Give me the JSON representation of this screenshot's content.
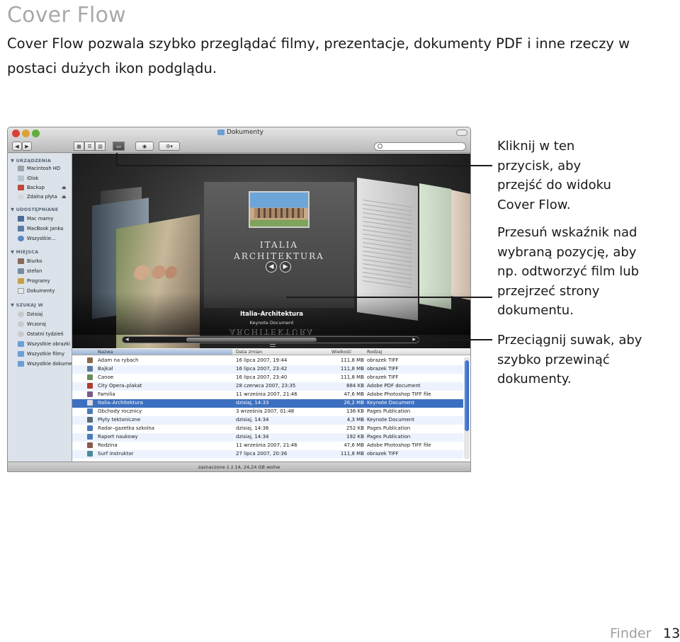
{
  "page": {
    "title": "Cover Flow",
    "intro": "Cover Flow pozwala szybko przeglądać filmy, prezentacje, dokumenty PDF i inne rzeczy w postaci dużych ikon podglądu.",
    "footer_section": "Finder",
    "page_number": "13"
  },
  "window": {
    "title": "Dokumenty",
    "search_placeholder": "",
    "status": "zaznaczone 1 z 14, 24,24 GB wolne"
  },
  "sidebar": {
    "sections": [
      {
        "header": "URZĄDZENIA",
        "items": [
          "Macintosh HD",
          "iDisk",
          "Backup",
          "Zdalna płyta"
        ]
      },
      {
        "header": "UDOSTĘPNIANE",
        "items": [
          "Mac mamy",
          "MacBook Janka",
          "Wszystkie..."
        ]
      },
      {
        "header": "MIEJSCA",
        "items": [
          "Biurko",
          "stefan",
          "Programy",
          "Dokumenty"
        ]
      },
      {
        "header": "SZUKAJ W",
        "items": [
          "Dzisiaj",
          "Wczoraj",
          "Ostatni tydzień",
          "Wszystkie obrazki",
          "Wszystkie filmy",
          "Wszystkie dokumenty"
        ]
      }
    ]
  },
  "coverflow": {
    "card_title_line1": "ITALIA",
    "card_title_line2": "ARCHITEKTURA",
    "caption_name": "Italia–Architektura",
    "caption_kind": "Keynote Document",
    "reflection_text": "ARCHITEKTURA"
  },
  "filelist": {
    "columns": [
      "Nazwa",
      "Data zmian",
      "Wielkość",
      "Rodzaj"
    ],
    "rows": [
      {
        "name": "Adam na rybach",
        "date": "16 lipca 2007, 19:44",
        "size": "111,8 MB",
        "kind": "obrazek TIFF",
        "icon": "#8a6a4a"
      },
      {
        "name": "Bajkał",
        "date": "16 lipca 2007, 23:42",
        "size": "111,8 MB",
        "kind": "obrazek TIFF",
        "icon": "#5f7a99"
      },
      {
        "name": "Canoe",
        "date": "16 lipca 2007, 23:40",
        "size": "111,8 MB",
        "kind": "obrazek TIFF",
        "icon": "#6b8a5a"
      },
      {
        "name": "City Opera–plakat",
        "date": "28 czerwca 2007, 23:35",
        "size": "884 KB",
        "kind": "Adobe PDF document",
        "icon": "#b33a2a"
      },
      {
        "name": "Familia",
        "date": "11 września 2007, 21:46",
        "size": "47,6 MB",
        "kind": "Adobe Photoshop TIFF file",
        "icon": "#7a5a8a"
      },
      {
        "name": "Italia–Architektura",
        "date": "dzisiaj, 14:33",
        "size": "26,2 MB",
        "kind": "Keynote Document",
        "icon": "#dddddd"
      },
      {
        "name": "Obchody rocznicy",
        "date": "3 września 2007, 01:48",
        "size": "136 KB",
        "kind": "Pages Publication",
        "icon": "#4a7ab8"
      },
      {
        "name": "Płyty tektoniczne",
        "date": "dzisiaj, 14:34",
        "size": "4,3 MB",
        "kind": "Keynote Document",
        "icon": "#5a6a7a"
      },
      {
        "name": "Radar–gazetka szkolna",
        "date": "dzisiaj, 14:36",
        "size": "252 KB",
        "kind": "Pages Publication",
        "icon": "#4a7ab8"
      },
      {
        "name": "Raport naukowy",
        "date": "dzisiaj, 14:34",
        "size": "192 KB",
        "kind": "Pages Publication",
        "icon": "#4a7ab8"
      },
      {
        "name": "Rodzina",
        "date": "11 września 2007, 21:46",
        "size": "47,6 MB",
        "kind": "Adobe Photoshop TIFF file",
        "icon": "#8a5a4a"
      },
      {
        "name": "Surf instruktor",
        "date": "27 lipca 2007, 20:36",
        "size": "111,8 MB",
        "kind": "obrazek TIFF",
        "icon": "#4a8a9a"
      }
    ],
    "selected_index": 5
  },
  "callouts": [
    "Kliknij w ten przycisk, aby przejść do widoku Cover Flow.",
    "Przesuń wskaźnik nad wybraną pozycję, aby np. odtworzyć film lub przejrzeć strony dokumentu.",
    "Przeciągnij suwak, aby szybko przewinąć dokumenty."
  ]
}
